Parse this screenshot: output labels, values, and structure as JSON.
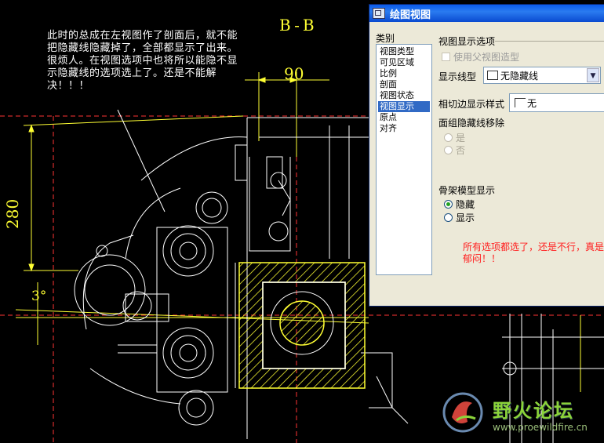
{
  "drawing": {
    "section_label": "B-B",
    "dim_90": "90",
    "dim_280": "280",
    "dim_angle": "3°"
  },
  "note_text": "此时的总成在左视图作了剖面后，就不能把隐藏线隐藏掉了，全部都显示了出来。很烦人。在视图选项中也将所以能隐不显示隐藏线的选项选上了。还是不能解决！！！",
  "dialog": {
    "title": "绘图视图",
    "category_label": "类别",
    "categories": [
      "视图类型",
      "可见区域",
      "比例",
      "剖面",
      "视图状态",
      "视图显示",
      "原点",
      "对齐"
    ],
    "selected_category": "视图显示",
    "section_title": "视图显示选项",
    "use_parent_label": "使用父视图造型",
    "display_linetype_label": "显示线型",
    "display_linetype_value": "无隐藏线",
    "tangent_label": "相切边显示样式",
    "tangent_value": "无",
    "hidden_remove_label": "面组隐藏线移除",
    "hidden_remove_options": [
      "是",
      "否"
    ],
    "skeleton_label": "骨架模型显示",
    "skeleton_options": [
      "隐藏",
      "显示"
    ],
    "skeleton_selected": "隐藏"
  },
  "red_note": "所有选项都选了，还是不行，真是郁闷！！",
  "watermark": {
    "title": "野火论坛",
    "url": "www.proewildfire.cn"
  },
  "colors": {
    "background": "#000000",
    "cad_lines": "#ffffff",
    "dimension": "#ffff33",
    "hatch": "#ffff33",
    "centerline": "#ff3333",
    "annotation_red": "#ff2020",
    "dialog_bg": "#ece9d8",
    "titlebar": "#0a5ae8",
    "selection": "#316ac5"
  }
}
